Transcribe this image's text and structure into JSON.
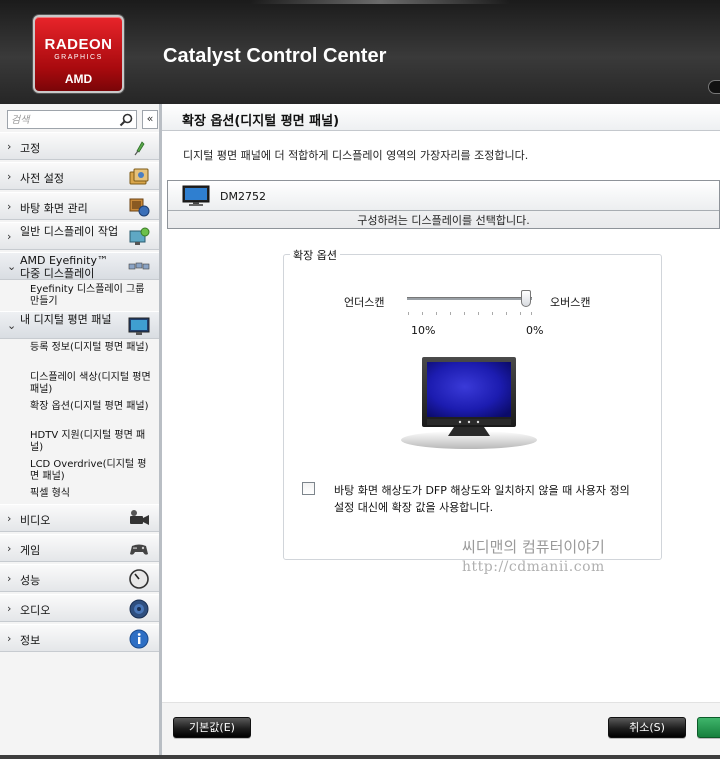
{
  "app": {
    "title": "Catalyst Control Center",
    "logo_line1": "RADEON",
    "logo_line2": "GRAPHICS",
    "logo_line3": "AMD"
  },
  "search": {
    "placeholder": "검색",
    "collapse_label": "«"
  },
  "sidebar": {
    "items": [
      {
        "label": "고정",
        "icon": "pin-icon"
      },
      {
        "label": "사전 설정",
        "icon": "presets-icon"
      },
      {
        "label": "바탕 화면 관리",
        "icon": "desktop-management-icon"
      },
      {
        "label": "일반 디스플레이 작업",
        "icon": "display-tasks-icon"
      },
      {
        "label": "AMD Eyefinity™ 다중 디스플레이",
        "icon": "eyefinity-icon"
      },
      {
        "label": "내 디지털 평면 패널",
        "icon": "flat-panel-icon"
      },
      {
        "label": "비디오",
        "icon": "video-camera-icon"
      },
      {
        "label": "게임",
        "icon": "gamepad-icon"
      },
      {
        "label": "성능",
        "icon": "gauge-icon"
      },
      {
        "label": "오디오",
        "icon": "speaker-icon"
      },
      {
        "label": "정보",
        "icon": "info-icon"
      }
    ],
    "eyefinity_sub": "Eyefinity 디스플레이 그룹 만들기",
    "panel_sub": [
      "등록 정보(디지털 평면 패널)",
      "디스플레이 색상(디지털 평면 패널)",
      "확장 옵션(디지털 평면 패널)",
      "HDTV 지원(디지털 평면 패널)",
      "LCD Overdrive(디지털 평면 패널)",
      "픽셀 형식"
    ]
  },
  "main": {
    "title": "확장 옵션(디지털 평면 패널)",
    "description": "디지털 평면 패널에 더 적합하게 디스플레이 영역의 가장자리를 조정합니다.",
    "display_name": "DM2752",
    "display_hint": "구성하려는 디스플레이를 선택합니다.",
    "group_title": "확장 옵션",
    "slider": {
      "left_label": "언더스캔",
      "right_label": "오버스캔",
      "min_label": "10%",
      "max_label": "0%",
      "value_fraction": 1.0
    },
    "checkbox": {
      "checked": false,
      "text": "바탕 화면 해상도가 DFP 해상도와 일치하지 않을 때 사용자 정의 설정 대신에 확장 값을 사용합니다."
    },
    "watermark_line1": "씨디맨의 컴퓨터이야기",
    "watermark_line2": "http://cdmanii.com"
  },
  "buttons": {
    "default_label": "기본값(E)",
    "cancel_label": "취소(S)"
  },
  "colors": {
    "brand_red": "#d3161c",
    "apply_green": "#2a9a52"
  }
}
